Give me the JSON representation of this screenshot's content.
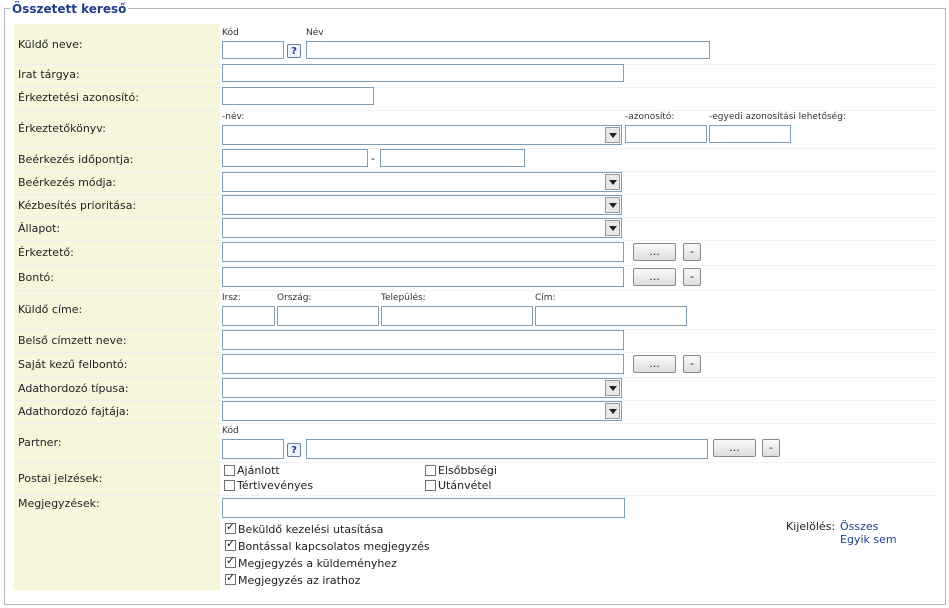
{
  "legend": "Összetett kereső",
  "labels": {
    "kuldo_neve": "Küldő neve:",
    "irat_targya": "Irat tárgya:",
    "erkeztetesi_azonosito": "Érkeztetési azonosító:",
    "erkeztetokonyv": "Érkeztetőkönyv:",
    "beerkezes_idopontja": "Beérkezés időpontja:",
    "beerkezes_modja": "Beérkezés módja:",
    "kezbesites_prioritasa": "Kézbesítés prioritása:",
    "allapot": "Állapot:",
    "erkezteto": "Érkeztető:",
    "bonto": "Bontó:",
    "kuldo_cime": "Küldő címe:",
    "belso_cimzett_neve": "Belső címzett neve:",
    "sajat_kezu_felbonto": "Saját kezű felbontó:",
    "adathordozo_tipusa": "Adathordozó típusa:",
    "adathordozo_fajtaja": "Adathordozó fajtája:",
    "partner": "Partner:",
    "postai_jelzesek": "Postai jelzések:",
    "megjegyzesek": "Megjegyzések:"
  },
  "sublabels": {
    "kod": "Kód",
    "nev": "Név",
    "konyv_nev": "-név:",
    "konyv_azonosito": "-azonosító:",
    "konyv_egyedi": "-egyedi azonosítási lehetőség:",
    "irsz": "Irsz:",
    "orszag": "Ország:",
    "telepules": "Település:",
    "cim": "Cím:",
    "partner_kod": "Kód"
  },
  "buttons": {
    "dots": "...",
    "minus": "-",
    "help": "?"
  },
  "date_separator": "-",
  "postai": {
    "ajanlott": "Ajánlott",
    "elsobbsegi": "Elsőbbségi",
    "tertivevenyes": "Tértivevényes",
    "utanvetel": "Utánvétel"
  },
  "notes": {
    "bekuldo": "Beküldő kezelési utasítása",
    "bontassal": "Bontással kapcsolatos megjegyzés",
    "kuldemenyhez": "Megjegyzés a küldeményhez",
    "irathoz": "Megjegyzés az irathoz"
  },
  "selection": {
    "label": "Kijelölés:",
    "all": "Összes",
    "none": "Egyik sem"
  }
}
